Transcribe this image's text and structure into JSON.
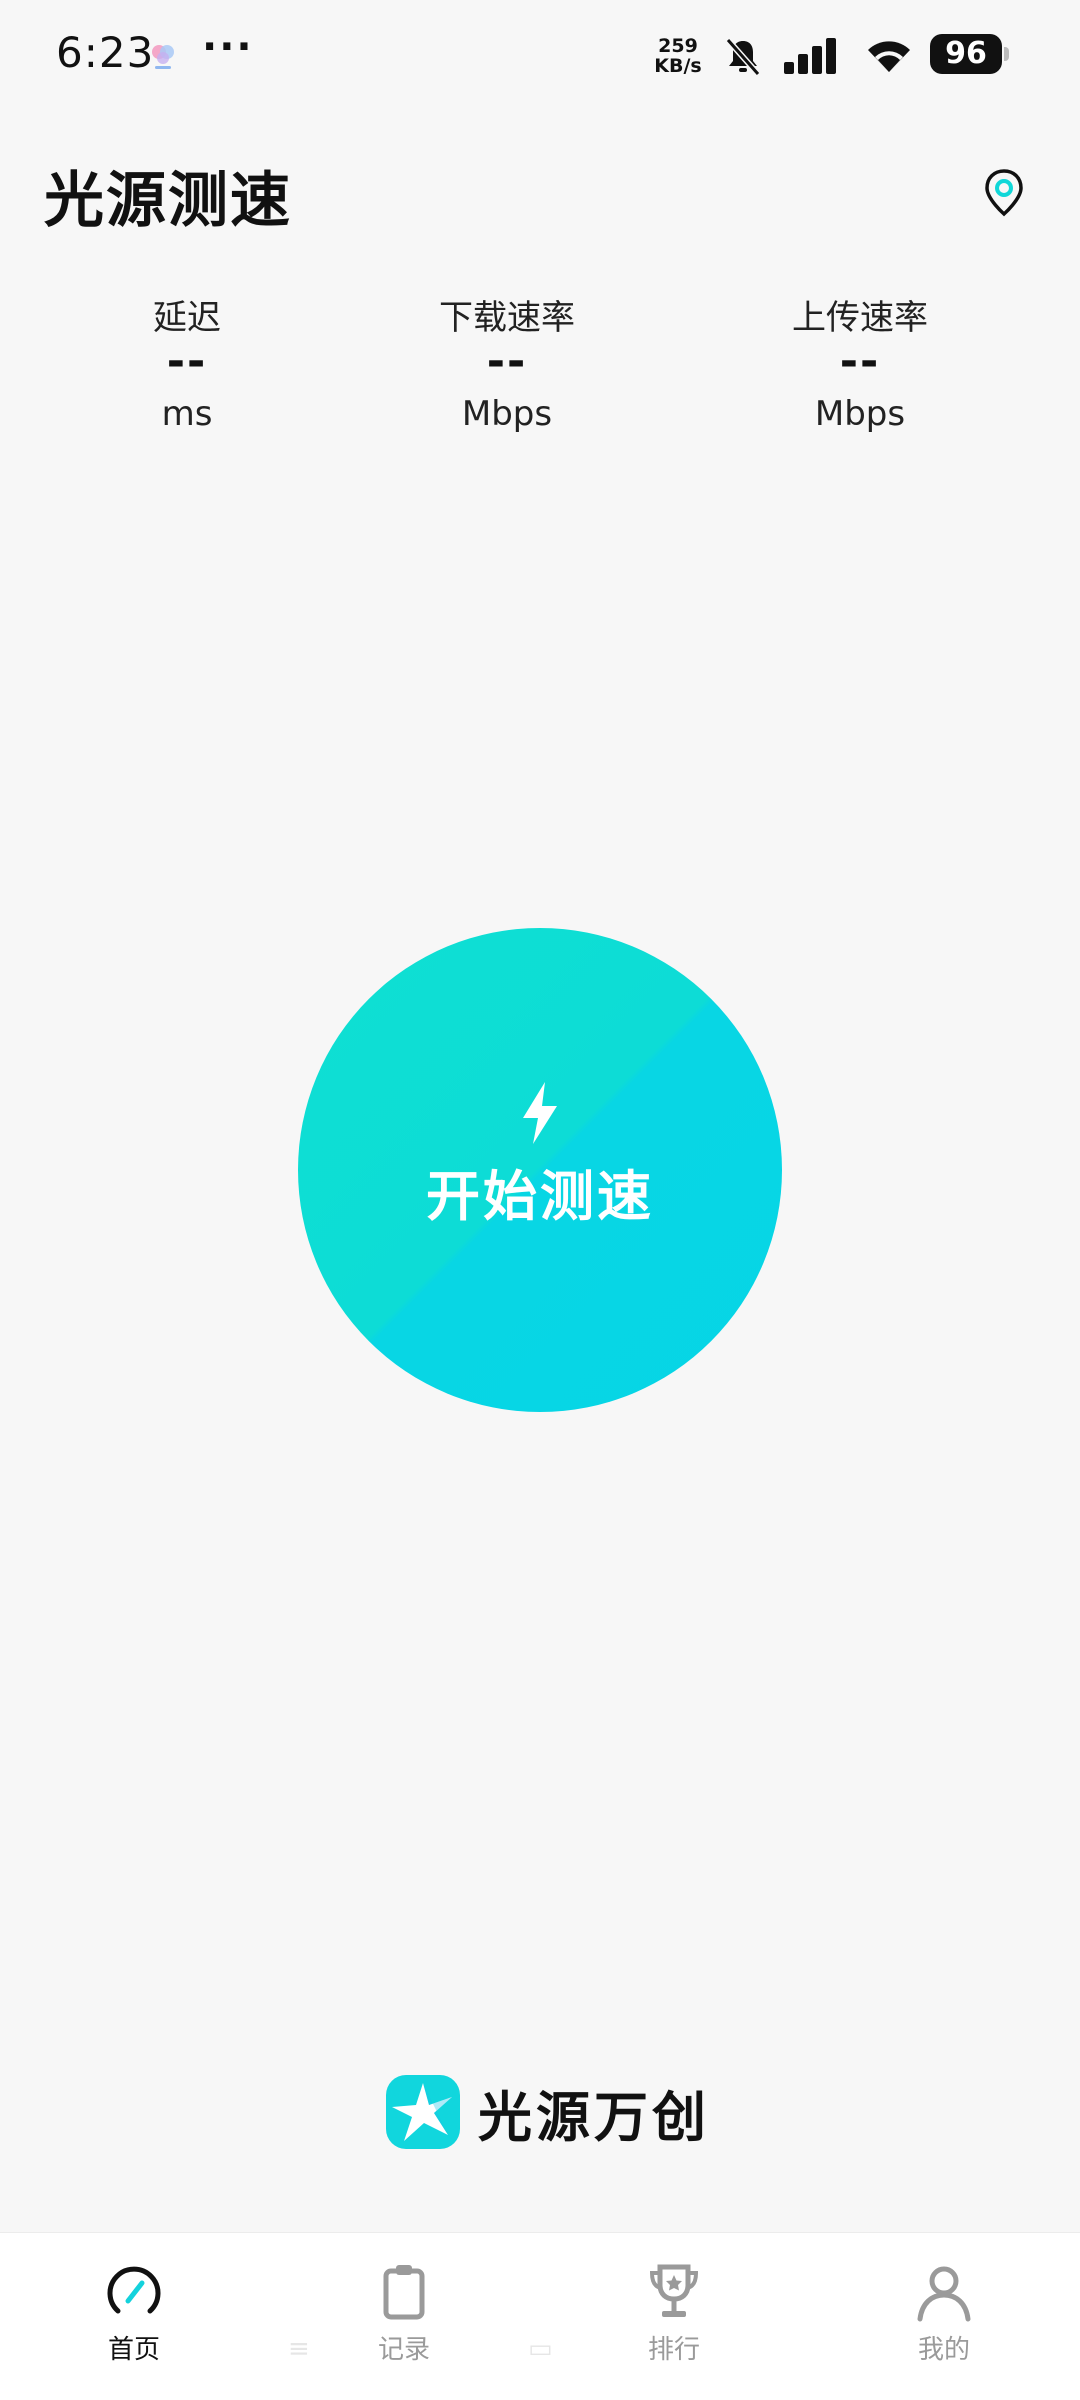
{
  "status_bar": {
    "time": "6:23",
    "more": "···",
    "net_speed_value": "259",
    "net_speed_unit": "KB/s",
    "battery": "96",
    "icons": [
      "notification-app-icon",
      "bell-off-icon",
      "signal-icon",
      "wifi-icon",
      "battery-icon"
    ]
  },
  "header": {
    "title": "光源测速",
    "location_icon": "location-pin-icon"
  },
  "metrics": [
    {
      "label": "延迟",
      "value": "--",
      "unit": "ms"
    },
    {
      "label": "下载速率",
      "value": "--",
      "unit": "Mbps"
    },
    {
      "label": "上传速率",
      "value": "--",
      "unit": "Mbps"
    }
  ],
  "start": {
    "label": "开始测速",
    "icon": "lightning-bolt-icon"
  },
  "brand": {
    "name": "光源万创",
    "logo": "brand-star-logo"
  },
  "nav": [
    {
      "label": "首页",
      "icon": "speedometer-icon",
      "active": true
    },
    {
      "label": "记录",
      "icon": "clipboard-icon",
      "active": false
    },
    {
      "label": "排行",
      "icon": "trophy-icon",
      "active": false
    },
    {
      "label": "我的",
      "icon": "person-icon",
      "active": false
    }
  ],
  "colors": {
    "accent": "#0ddcd6",
    "accent_secondary": "#06d5e6",
    "background": "#f7f7f7",
    "nav_inactive": "#9a9a9a"
  }
}
